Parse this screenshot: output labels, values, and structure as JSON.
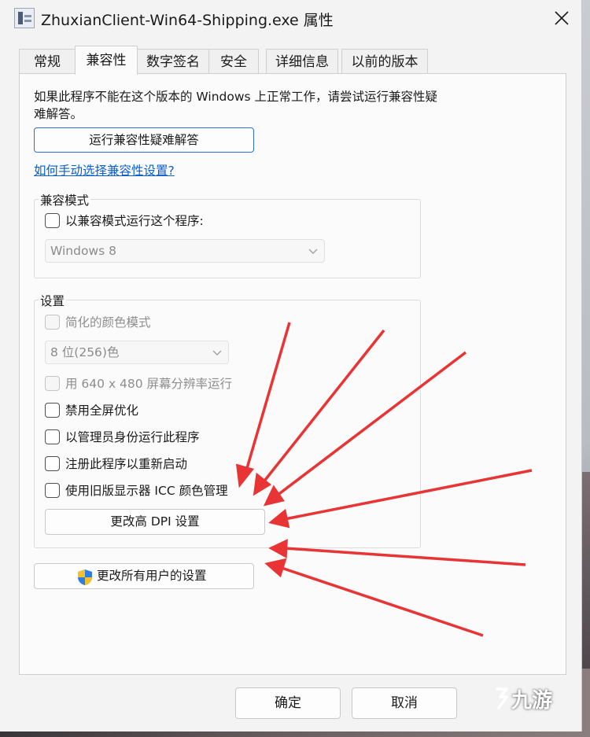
{
  "window": {
    "title": "ZhuxianClient-Win64-Shipping.exe 属性"
  },
  "tabs": [
    {
      "label": "常规",
      "active": false
    },
    {
      "label": "兼容性",
      "active": true
    },
    {
      "label": "数字签名",
      "active": false
    },
    {
      "label": "安全",
      "active": false
    },
    {
      "label": "详细信息",
      "active": false
    },
    {
      "label": "以前的版本",
      "active": false
    }
  ],
  "compat": {
    "description": "如果此程序不能在这个版本的 Windows 上正常工作，请尝试运行兼容性疑难解答。",
    "troubleshoot_button": "运行兼容性疑难解答",
    "manual_link": "如何手动选择兼容性设置?"
  },
  "compat_mode": {
    "group_title": "兼容模式",
    "checkbox_label": "以兼容模式运行这个程序:",
    "checked": false,
    "os_select_value": "Windows 8"
  },
  "settings": {
    "group_title": "设置",
    "reduced_color_label": "简化的颜色模式",
    "color_select_value": "8 位(256)色",
    "res_640_label": "用 640 x 480 屏幕分辨率运行",
    "disable_fullscreen_label": "禁用全屏优化",
    "run_as_admin_label": "以管理员身份运行此程序",
    "register_restart_label": "注册此程序以重新启动",
    "legacy_icc_label": "使用旧版显示器 ICC 颜色管理",
    "high_dpi_button": "更改高 DPI 设置"
  },
  "all_users_button": "更改所有用户的设置",
  "footer": {
    "ok_button": "确定",
    "cancel_button": "取消"
  },
  "watermark": {
    "text": "九游"
  },
  "colors": {
    "accent": "#2a6fd6",
    "link": "#0b5fcf",
    "annotation_arrow": "#e83434"
  }
}
